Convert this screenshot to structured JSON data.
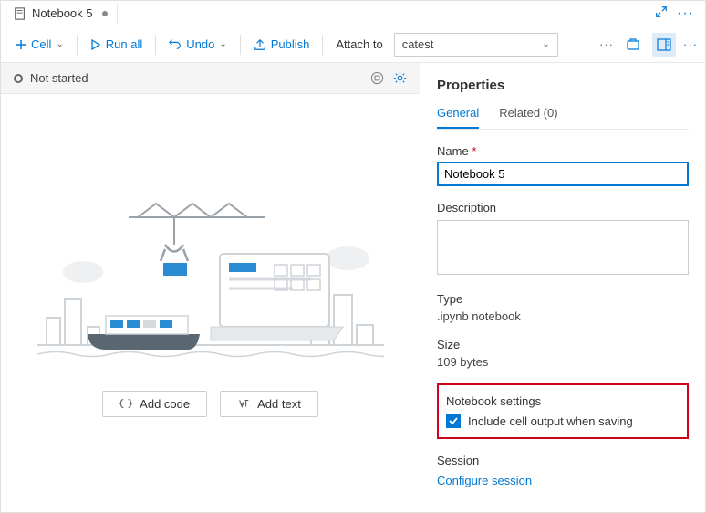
{
  "tab": {
    "title": "Notebook 5"
  },
  "toolbar": {
    "cell": "Cell",
    "run_all": "Run all",
    "undo": "Undo",
    "publish": "Publish",
    "attach_label": "Attach to",
    "attach_value": "catest"
  },
  "status": {
    "text": "Not started"
  },
  "empty": {
    "add_code": "Add code",
    "add_text": "Add text"
  },
  "props": {
    "title": "Properties",
    "tab_general": "General",
    "tab_related": "Related (0)",
    "name_label": "Name",
    "name_value": "Notebook 5",
    "desc_label": "Description",
    "type_label": "Type",
    "type_value": ".ipynb notebook",
    "size_label": "Size",
    "size_value": "109 bytes",
    "settings_label": "Notebook settings",
    "checkbox_label": "Include cell output when saving",
    "session_label": "Session",
    "configure_session": "Configure session"
  }
}
